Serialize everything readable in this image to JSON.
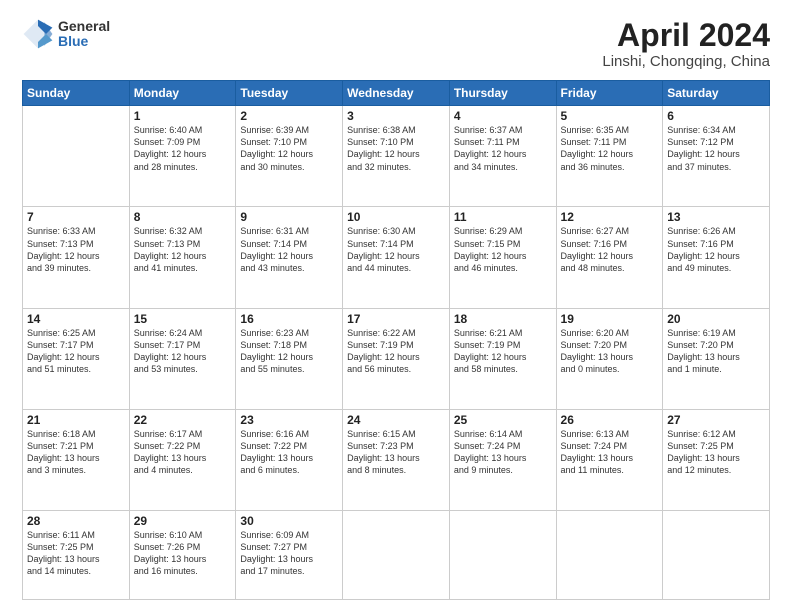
{
  "logo": {
    "general": "General",
    "blue": "Blue"
  },
  "title": {
    "month": "April 2024",
    "location": "Linshi, Chongqing, China"
  },
  "weekdays": [
    "Sunday",
    "Monday",
    "Tuesday",
    "Wednesday",
    "Thursday",
    "Friday",
    "Saturday"
  ],
  "weeks": [
    [
      {
        "num": "",
        "info": ""
      },
      {
        "num": "1",
        "info": "Sunrise: 6:40 AM\nSunset: 7:09 PM\nDaylight: 12 hours\nand 28 minutes."
      },
      {
        "num": "2",
        "info": "Sunrise: 6:39 AM\nSunset: 7:10 PM\nDaylight: 12 hours\nand 30 minutes."
      },
      {
        "num": "3",
        "info": "Sunrise: 6:38 AM\nSunset: 7:10 PM\nDaylight: 12 hours\nand 32 minutes."
      },
      {
        "num": "4",
        "info": "Sunrise: 6:37 AM\nSunset: 7:11 PM\nDaylight: 12 hours\nand 34 minutes."
      },
      {
        "num": "5",
        "info": "Sunrise: 6:35 AM\nSunset: 7:11 PM\nDaylight: 12 hours\nand 36 minutes."
      },
      {
        "num": "6",
        "info": "Sunrise: 6:34 AM\nSunset: 7:12 PM\nDaylight: 12 hours\nand 37 minutes."
      }
    ],
    [
      {
        "num": "7",
        "info": "Sunrise: 6:33 AM\nSunset: 7:13 PM\nDaylight: 12 hours\nand 39 minutes."
      },
      {
        "num": "8",
        "info": "Sunrise: 6:32 AM\nSunset: 7:13 PM\nDaylight: 12 hours\nand 41 minutes."
      },
      {
        "num": "9",
        "info": "Sunrise: 6:31 AM\nSunset: 7:14 PM\nDaylight: 12 hours\nand 43 minutes."
      },
      {
        "num": "10",
        "info": "Sunrise: 6:30 AM\nSunset: 7:14 PM\nDaylight: 12 hours\nand 44 minutes."
      },
      {
        "num": "11",
        "info": "Sunrise: 6:29 AM\nSunset: 7:15 PM\nDaylight: 12 hours\nand 46 minutes."
      },
      {
        "num": "12",
        "info": "Sunrise: 6:27 AM\nSunset: 7:16 PM\nDaylight: 12 hours\nand 48 minutes."
      },
      {
        "num": "13",
        "info": "Sunrise: 6:26 AM\nSunset: 7:16 PM\nDaylight: 12 hours\nand 49 minutes."
      }
    ],
    [
      {
        "num": "14",
        "info": "Sunrise: 6:25 AM\nSunset: 7:17 PM\nDaylight: 12 hours\nand 51 minutes."
      },
      {
        "num": "15",
        "info": "Sunrise: 6:24 AM\nSunset: 7:17 PM\nDaylight: 12 hours\nand 53 minutes."
      },
      {
        "num": "16",
        "info": "Sunrise: 6:23 AM\nSunset: 7:18 PM\nDaylight: 12 hours\nand 55 minutes."
      },
      {
        "num": "17",
        "info": "Sunrise: 6:22 AM\nSunset: 7:19 PM\nDaylight: 12 hours\nand 56 minutes."
      },
      {
        "num": "18",
        "info": "Sunrise: 6:21 AM\nSunset: 7:19 PM\nDaylight: 12 hours\nand 58 minutes."
      },
      {
        "num": "19",
        "info": "Sunrise: 6:20 AM\nSunset: 7:20 PM\nDaylight: 13 hours\nand 0 minutes."
      },
      {
        "num": "20",
        "info": "Sunrise: 6:19 AM\nSunset: 7:20 PM\nDaylight: 13 hours\nand 1 minute."
      }
    ],
    [
      {
        "num": "21",
        "info": "Sunrise: 6:18 AM\nSunset: 7:21 PM\nDaylight: 13 hours\nand 3 minutes."
      },
      {
        "num": "22",
        "info": "Sunrise: 6:17 AM\nSunset: 7:22 PM\nDaylight: 13 hours\nand 4 minutes."
      },
      {
        "num": "23",
        "info": "Sunrise: 6:16 AM\nSunset: 7:22 PM\nDaylight: 13 hours\nand 6 minutes."
      },
      {
        "num": "24",
        "info": "Sunrise: 6:15 AM\nSunset: 7:23 PM\nDaylight: 13 hours\nand 8 minutes."
      },
      {
        "num": "25",
        "info": "Sunrise: 6:14 AM\nSunset: 7:24 PM\nDaylight: 13 hours\nand 9 minutes."
      },
      {
        "num": "26",
        "info": "Sunrise: 6:13 AM\nSunset: 7:24 PM\nDaylight: 13 hours\nand 11 minutes."
      },
      {
        "num": "27",
        "info": "Sunrise: 6:12 AM\nSunset: 7:25 PM\nDaylight: 13 hours\nand 12 minutes."
      }
    ],
    [
      {
        "num": "28",
        "info": "Sunrise: 6:11 AM\nSunset: 7:25 PM\nDaylight: 13 hours\nand 14 minutes."
      },
      {
        "num": "29",
        "info": "Sunrise: 6:10 AM\nSunset: 7:26 PM\nDaylight: 13 hours\nand 16 minutes."
      },
      {
        "num": "30",
        "info": "Sunrise: 6:09 AM\nSunset: 7:27 PM\nDaylight: 13 hours\nand 17 minutes."
      },
      {
        "num": "",
        "info": ""
      },
      {
        "num": "",
        "info": ""
      },
      {
        "num": "",
        "info": ""
      },
      {
        "num": "",
        "info": ""
      }
    ]
  ]
}
